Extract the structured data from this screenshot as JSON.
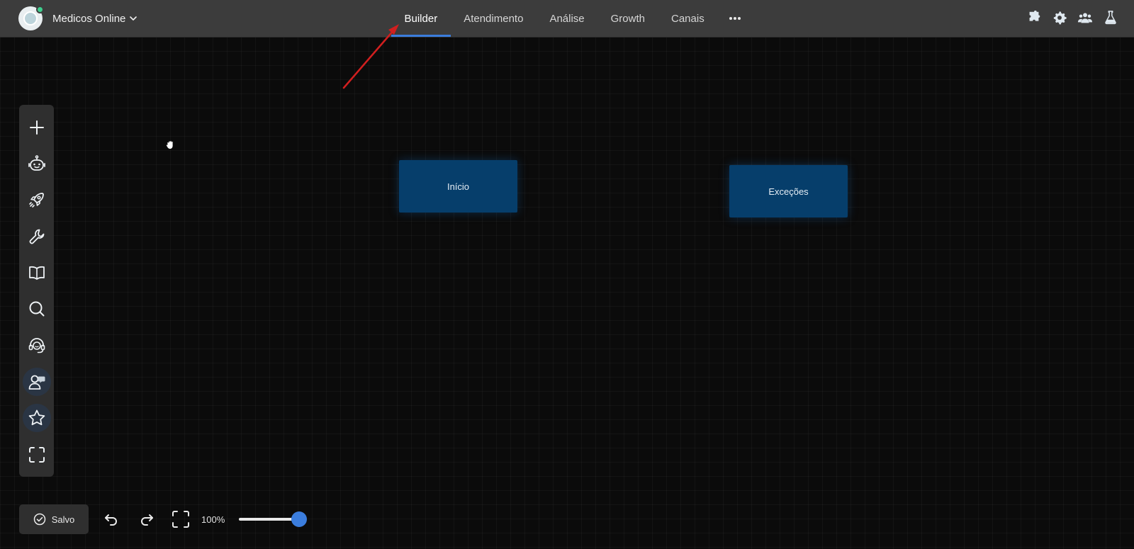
{
  "header": {
    "workspace_name": "Medicos Online",
    "tabs": [
      {
        "label": "Builder",
        "active": true
      },
      {
        "label": "Atendimento",
        "active": false
      },
      {
        "label": "Análise",
        "active": false
      },
      {
        "label": "Growth",
        "active": false
      },
      {
        "label": "Canais",
        "active": false
      }
    ],
    "right_icons": [
      "puzzle-icon",
      "gear-icon",
      "team-icon",
      "flask-icon"
    ],
    "accent_color": "#3b7ddd"
  },
  "sidebar": {
    "items": [
      {
        "icon": "plus-icon"
      },
      {
        "icon": "bot-icon"
      },
      {
        "icon": "rocket-icon"
      },
      {
        "icon": "wrench-icon"
      },
      {
        "icon": "book-icon"
      },
      {
        "icon": "search-icon"
      },
      {
        "icon": "support-agent-icon"
      },
      {
        "icon": "user-chat-icon"
      },
      {
        "icon": "star-icon"
      },
      {
        "icon": "fullscreen-icon"
      }
    ]
  },
  "canvas": {
    "nodes": [
      {
        "label": "Início"
      },
      {
        "label": "Exceções"
      }
    ],
    "node_color": "#063e6b"
  },
  "bottombar": {
    "saved_label": "Salvo",
    "zoom_label": "100%",
    "zoom_value": 100
  }
}
